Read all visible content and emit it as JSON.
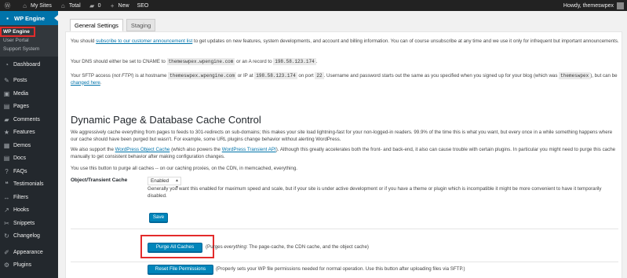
{
  "adminbar": {
    "wp_icon": "wordpress-logo-icon",
    "my_sites": "My Sites",
    "site_name": "Total",
    "comments_count": "0",
    "new_label": "New",
    "seo_label": "SEO",
    "howdy": "Howdy, themeswpex"
  },
  "sidebar": {
    "current": "WP Engine",
    "submenu": [
      "WP Engine",
      "User Portal",
      "Support System"
    ],
    "items": [
      {
        "label": "Dashboard",
        "icon": "dashboard-icon",
        "glyph": "◔"
      },
      {
        "label": "Posts",
        "icon": "pin-icon",
        "glyph": "✎"
      },
      {
        "label": "Media",
        "icon": "media-icon",
        "glyph": "▣"
      },
      {
        "label": "Pages",
        "icon": "pages-icon",
        "glyph": "▤"
      },
      {
        "label": "Comments",
        "icon": "comment-icon",
        "glyph": "▰"
      },
      {
        "label": "Features",
        "icon": "star-icon",
        "glyph": "★"
      },
      {
        "label": "Demos",
        "icon": "demos-icon",
        "glyph": "▦"
      },
      {
        "label": "Docs",
        "icon": "docs-icon",
        "glyph": "▤"
      },
      {
        "label": "FAQs",
        "icon": "help-icon",
        "glyph": "?"
      },
      {
        "label": "Testimonials",
        "icon": "testimonial-icon",
        "glyph": "❝"
      },
      {
        "label": "Filters",
        "icon": "filter-icon",
        "glyph": "↔"
      },
      {
        "label": "Hooks",
        "icon": "hooks-icon",
        "glyph": "↗"
      },
      {
        "label": "Snippets",
        "icon": "snippets-icon",
        "glyph": "✂"
      },
      {
        "label": "Changelog",
        "icon": "changelog-icon",
        "glyph": "↻"
      },
      {
        "label": "Appearance",
        "icon": "appearance-icon",
        "glyph": "✐"
      },
      {
        "label": "Plugins",
        "icon": "plugins-icon",
        "glyph": "⚙"
      }
    ]
  },
  "tabs": [
    "General Settings",
    "Staging"
  ],
  "intro": {
    "p1_pre": "You should ",
    "p1_link": "subscribe to our customer announcement list",
    "p1_post": " to get updates on new features, system developments, and account and billing information. You can of course unsubscribe at any time and we use it only for infrequent but important announcements.",
    "p2_pre": "Your DNS should either be set to CNAME to ",
    "p2_code1": "themeswpex.wpengine.com",
    "p2_mid": " or an A record to ",
    "p2_code2": "198.58.123.174",
    "p2_post": ".",
    "p3_a": "Your SFTP access (",
    "p3_em": "not FTP!",
    "p3_b": ") is at hostname ",
    "p3_code1": "themeswpex.wpengine.com",
    "p3_c": " or IP at ",
    "p3_code2": "198.58.123.174",
    "p3_d": " on port ",
    "p3_code3": "22",
    "p3_e": ". Username and password starts out the same as you specified when you signed up for your blog (which was ",
    "p3_code4": "themeswpex",
    "p3_f": "), but can be ",
    "p3_link": "changed here",
    "p3_g": "."
  },
  "cache": {
    "heading": "Dynamic Page & Database Cache Control",
    "p1": "We aggressively cache everything from pages to feeds to 301-redirects on sub-domains; this makes your site load lightning-fast for your non-logged-in readers. 99.9% of the time this is what you want, but every once in a while something happens where our cache should have been purged but wasn't. For example, some URL plugins change behavior without alerting WordPress.",
    "p2_a": "We also support the ",
    "p2_link1": "WordPress Object Cache",
    "p2_b": " (which also powers the ",
    "p2_link2": "WordPress Transient API",
    "p2_c": "). Although this greatly accelerates both the front- and back-end, it also can cause trouble with certain plugins. In particular you might need to purge this cache manually to get consistent behavior after making configuration changes.",
    "p3": "You use this button to purge all caches -- on our caching proxies, on the CDN, in memcached, everything.",
    "object_label": "Object/Transient Cache",
    "select_value": "Enabled",
    "object_desc": "Generally you want this enabled for maximum speed and scale, but if your site is under active development or if you have a theme or plugin which is incompatible it might be more convenient to have it temporarily disabled.",
    "save_label": "Save",
    "purge_label": "Purge All Caches",
    "purge_desc_a": "(Purges ",
    "purge_desc_em": "everything",
    "purge_desc_b": ": The page-cache, the CDN cache, and the object cache)",
    "reset_label": "Reset File Permissions",
    "reset_desc": "(Properly sets your WP file permissions needed for normal operation. Use this button after uploading files via SFTP.)"
  },
  "colors": {
    "accent": "#0073aa",
    "highlight": "#e32b2b",
    "sidebar_bg": "#23282d",
    "adminbar_bg": "#222222"
  }
}
